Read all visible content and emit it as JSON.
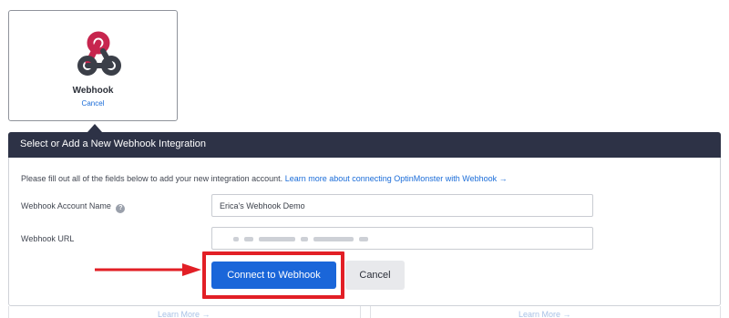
{
  "integration_card": {
    "name": "Webhook",
    "cancel_label": "Cancel",
    "logo_icon": "webhook-icon"
  },
  "panel": {
    "title": "Select or Add a New Webhook Integration",
    "intro_text": "Please fill out all of the fields below to add your new integration account.",
    "learn_link": "Learn more about connecting OptinMonster with Webhook →"
  },
  "form": {
    "account_name_label": "Webhook Account Name",
    "help_icon": "help-circle-icon",
    "account_name_value": "Erica's Webhook Demo",
    "url_label": "Webhook URL",
    "url_value": ""
  },
  "buttons": {
    "connect": "Connect to Webhook",
    "cancel": "Cancel"
  },
  "annotation": {
    "highlight_color": "#e21f26"
  },
  "below": {
    "learn_more_left": "Learn More →",
    "learn_more_right": "Learn More →"
  },
  "colors": {
    "header_bg": "#2d3246",
    "primary": "#1a66d9",
    "link": "#1a6cd8"
  }
}
